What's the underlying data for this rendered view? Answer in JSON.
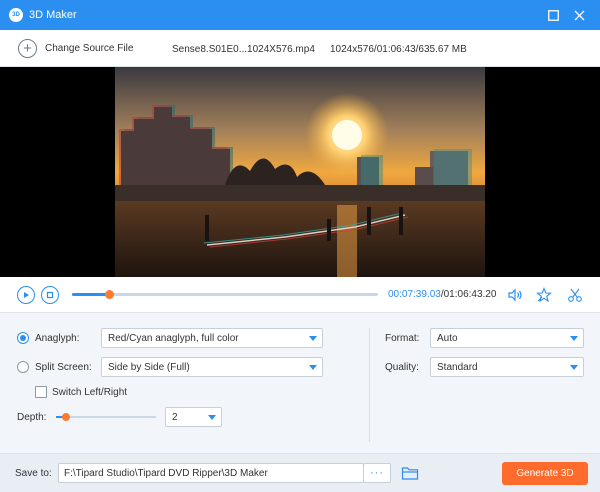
{
  "window": {
    "title": "3D Maker",
    "icon_text": "3D",
    "icons": {
      "maximize": "maximize-icon",
      "close": "close-icon"
    }
  },
  "source": {
    "add_label": "Change Source File",
    "file_name": "Sense8.S01E0...1024X576.mp4",
    "file_info": "1024x576/01:06:43/635.67 MB"
  },
  "playback": {
    "current_time": "00:07:39.03",
    "total_time": "/01:06:43.20",
    "progress": 0.12,
    "icons": {
      "play": "play-icon",
      "stop": "stop-icon",
      "volume": "volume-icon",
      "effect": "effect-icon",
      "clip": "scissors-icon"
    }
  },
  "settings": {
    "anaglyph": {
      "label": "Anaglyph:",
      "selected": true,
      "value": "Red/Cyan anaglyph, full color"
    },
    "split_screen": {
      "label": "Split Screen:",
      "selected": false,
      "value": "Side by Side (Full)"
    },
    "switch_lr": {
      "label": "Switch Left/Right",
      "checked": false
    },
    "depth": {
      "label": "Depth:",
      "value": "2",
      "level": 0.1
    },
    "format": {
      "label": "Format:",
      "value": "Auto"
    },
    "quality": {
      "label": "Quality:",
      "value": "Standard"
    }
  },
  "output": {
    "save_label": "Save to:",
    "path": "F:\\Tipard Studio\\Tipard DVD Ripper\\3D Maker",
    "browse_label": "···",
    "generate_label": "Generate 3D"
  },
  "colors": {
    "accent": "#2a8ff0",
    "orange": "#ff6b2c",
    "knob": "#ff7a2f"
  }
}
